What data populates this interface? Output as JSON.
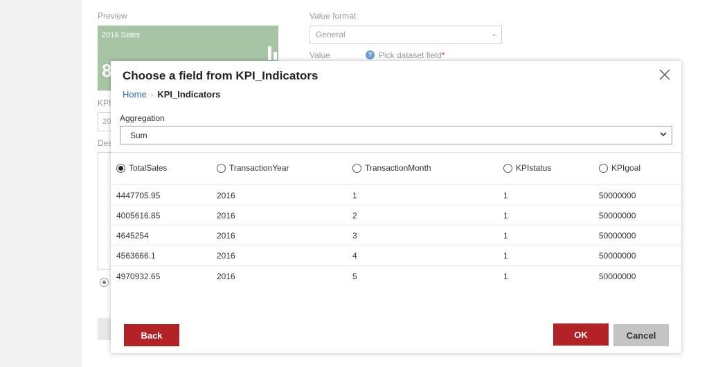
{
  "background": {
    "preview_label": "Preview",
    "preview_card": {
      "title": "2016 Sales",
      "big_value_partial": "8"
    },
    "value_format_label": "Value format",
    "value_format_selected": "General",
    "value_label": "Value",
    "pick_field_text": "Pick dataset field",
    "required_mark": "*",
    "kpi_label_partial": "KPI",
    "kpi_input_partial": "20",
    "description_label_partial": "Des"
  },
  "dialog": {
    "title": "Choose a field from KPI_Indicators",
    "breadcrumb": {
      "home": "Home",
      "separator": "›",
      "current": "KPI_Indicators"
    },
    "aggregation": {
      "label": "Aggregation",
      "selected": "Sum"
    },
    "columns": [
      {
        "label": "TotalSales",
        "selected": true
      },
      {
        "label": "TransactionYear",
        "selected": false
      },
      {
        "label": "TransactionMonth",
        "selected": false
      },
      {
        "label": "KPIstatus",
        "selected": false
      },
      {
        "label": "KPIgoal",
        "selected": false
      }
    ],
    "rows": [
      [
        "4447705.95",
        "2016",
        "1",
        "1",
        "50000000"
      ],
      [
        "4005616.85",
        "2016",
        "2",
        "1",
        "50000000"
      ],
      [
        "4645254",
        "2016",
        "3",
        "1",
        "50000000"
      ],
      [
        "4563666.1",
        "2016",
        "4",
        "1",
        "50000000"
      ],
      [
        "4970932.65",
        "2016",
        "5",
        "1",
        "50000000"
      ]
    ],
    "buttons": {
      "back": "Back",
      "ok": "OK",
      "cancel": "Cancel"
    }
  },
  "colors": {
    "accent_red": "#b22226",
    "link_blue": "#2a6cc4",
    "preview_green": "#a7c5a5",
    "cancel_gray": "#c4c4c4"
  }
}
